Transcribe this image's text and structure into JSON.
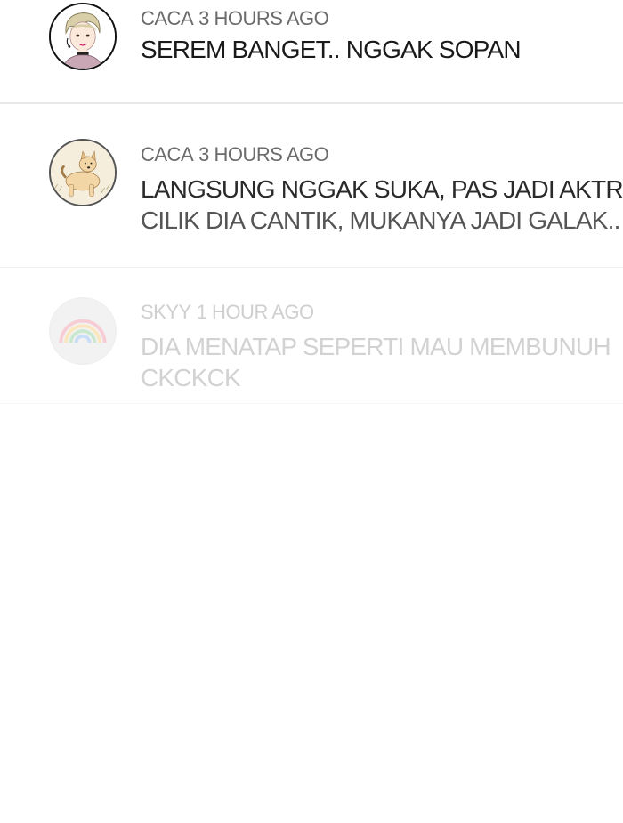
{
  "comments": [
    {
      "author": "CACA",
      "time": "3 HOURS AGO",
      "lines": [
        "SEREM BANGET.. NGGAK SOPAN"
      ],
      "avatar_icon": "boy-avatar-icon"
    },
    {
      "author": "CACA",
      "time": "3 HOURS AGO",
      "lines": [
        "LANGSUNG NGGAK SUKA, PAS JADI AKTRIS",
        "CILIK DIA CANTIK, MUKANYA JADI GALAK.."
      ],
      "avatar_icon": "dog-avatar-icon"
    },
    {
      "author": "SKYY",
      "time": "1 HOUR AGO",
      "lines": [
        "DIA MENATAP SEPERTI MAU MEMBUNUH",
        "CKCKCK"
      ],
      "avatar_icon": "rainbow-avatar-icon"
    }
  ]
}
